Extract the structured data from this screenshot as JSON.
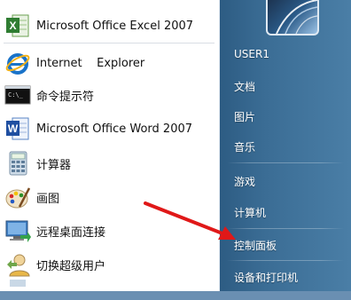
{
  "programs": [
    {
      "label": "Microsoft Office Excel 2007",
      "icon": "excel-icon"
    },
    {
      "label": "Internet    Explorer",
      "icon": "internet-explorer-icon"
    },
    {
      "label": "命令提示符",
      "icon": "command-prompt-icon"
    },
    {
      "label": "Microsoft Office Word 2007",
      "icon": "word-icon"
    },
    {
      "label": "计算器",
      "icon": "calculator-icon"
    },
    {
      "label": "画图",
      "icon": "paint-icon"
    },
    {
      "label": "远程桌面连接",
      "icon": "remote-desktop-icon"
    },
    {
      "label": "切换超级用户",
      "icon": "switch-user-icon"
    }
  ],
  "places": [
    {
      "label": "USER1"
    },
    {
      "label": "文档"
    },
    {
      "label": "图片"
    },
    {
      "label": "音乐"
    },
    {
      "label": "游戏"
    },
    {
      "label": "计算机"
    },
    {
      "label": "控制面板"
    },
    {
      "label": "设备和打印机"
    }
  ],
  "colors": {
    "right_pane": "#3b6d95",
    "arrow": "#e01818"
  }
}
